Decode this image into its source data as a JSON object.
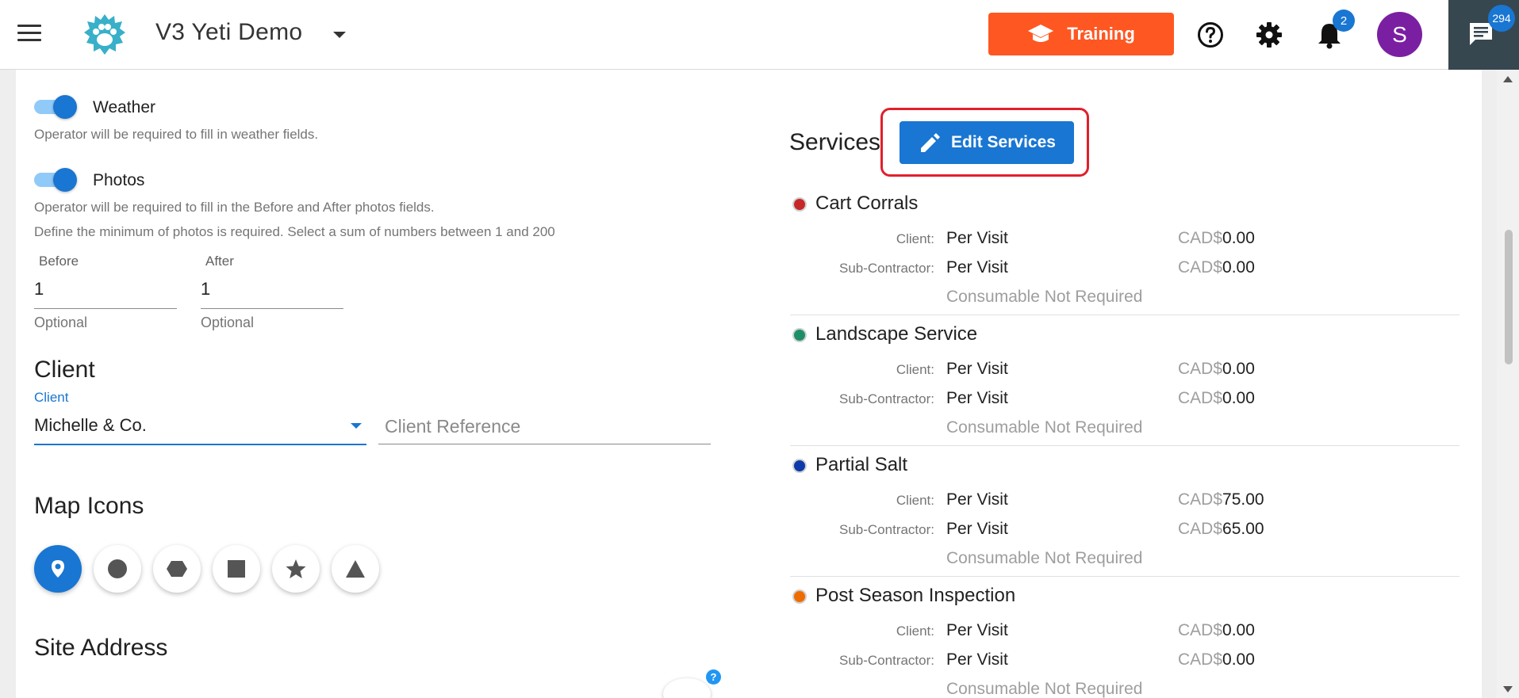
{
  "header": {
    "app_title": "V3 Yeti Demo",
    "training_label": "Training",
    "notification_count": "2",
    "avatar_initial": "S",
    "chat_count": "294",
    "accent": "#1976d2",
    "training_color": "#ff5722"
  },
  "settings": {
    "weather": {
      "label": "Weather",
      "enabled": true,
      "helper": "Operator will be required to fill in weather fields."
    },
    "photos": {
      "label": "Photos",
      "enabled": true,
      "helper": "Operator will be required to fill in the Before and After photos fields.",
      "helper2": "Define the minimum of photos is required. Select a sum of numbers between 1 and 200",
      "before": {
        "label": "Before",
        "value": "1",
        "hint": "Optional"
      },
      "after": {
        "label": "After",
        "value": "1",
        "hint": "Optional"
      }
    }
  },
  "client_section": {
    "title": "Client",
    "client_label": "Client",
    "client_value": "Michelle & Co.",
    "reference_placeholder": "Client Reference"
  },
  "map_icons": {
    "title": "Map Icons",
    "icons": [
      "map-pin",
      "circle",
      "hexagon",
      "square",
      "star",
      "triangle"
    ],
    "selected": "map-pin"
  },
  "site_address": {
    "title": "Site Address"
  },
  "services": {
    "title": "Services",
    "edit_label": "Edit Services",
    "client_label": "Client:",
    "sub_label": "Sub-Contractor:",
    "currency": "CAD$",
    "items": [
      {
        "name": "Cart Corrals",
        "color": "#c62828",
        "client_rate": "Per Visit",
        "client_price": "0.00",
        "sub_rate": "Per Visit",
        "sub_price": "0.00",
        "consumable": "Consumable Not Required"
      },
      {
        "name": "Landscape Service",
        "color": "#1e8e6a",
        "client_rate": "Per Visit",
        "client_price": "0.00",
        "sub_rate": "Per Visit",
        "sub_price": "0.00",
        "consumable": "Consumable Not Required"
      },
      {
        "name": "Partial Salt",
        "color": "#0d3aa9",
        "client_rate": "Per Visit",
        "client_price": "75.00",
        "sub_rate": "Per Visit",
        "sub_price": "65.00",
        "consumable": "Consumable Not Required"
      },
      {
        "name": "Post Season Inspection",
        "color": "#ef6c00",
        "client_rate": "Per Visit",
        "client_price": "0.00",
        "sub_rate": "Per Visit",
        "sub_price": "0.00",
        "consumable": "Consumable Not Required"
      }
    ]
  }
}
